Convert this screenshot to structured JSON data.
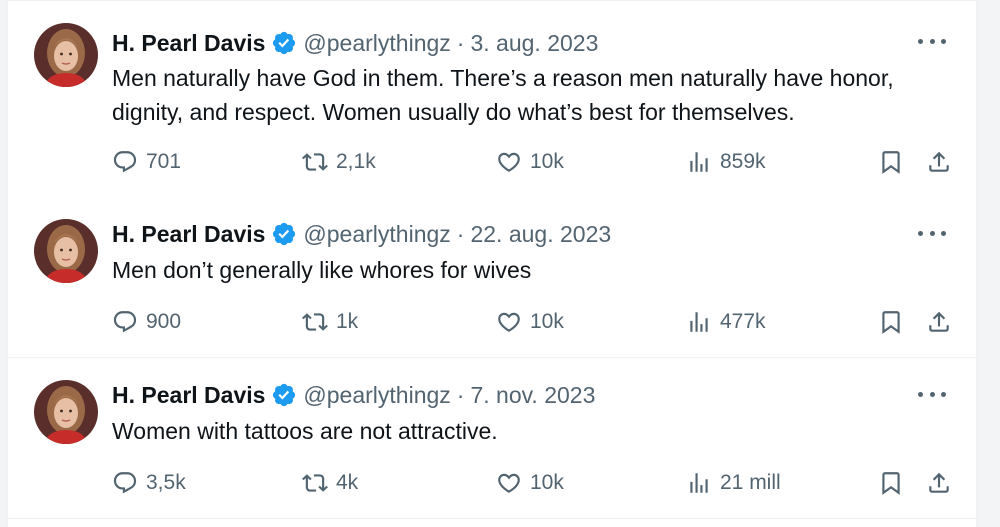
{
  "colors": {
    "verified_blue": "#1d9bf0",
    "text_primary": "#0f1419",
    "text_secondary": "#536471"
  },
  "tweets": [
    {
      "display_name": "H. Pearl Davis",
      "handle": "@pearlythingz",
      "separator": "·",
      "date": "3. aug. 2023",
      "text": "Men naturally have God in them. There’s a reason men naturally have honor, dignity, and respect. Women usually do what’s best for themselves.",
      "replies": "701",
      "retweets": "2,1k",
      "likes": "10k",
      "views": "859k"
    },
    {
      "display_name": "H. Pearl Davis",
      "handle": "@pearlythingz",
      "separator": "·",
      "date": "22. aug. 2023",
      "text": "Men don’t generally like whores for wives",
      "replies": "900",
      "retweets": "1k",
      "likes": "10k",
      "views": "477k"
    },
    {
      "display_name": "H. Pearl Davis",
      "handle": "@pearlythingz",
      "separator": "·",
      "date": "7. nov. 2023",
      "text": "Women with tattoos are not attractive.",
      "replies": "3,5k",
      "retweets": "4k",
      "likes": "10k",
      "views": "21 mill"
    }
  ]
}
